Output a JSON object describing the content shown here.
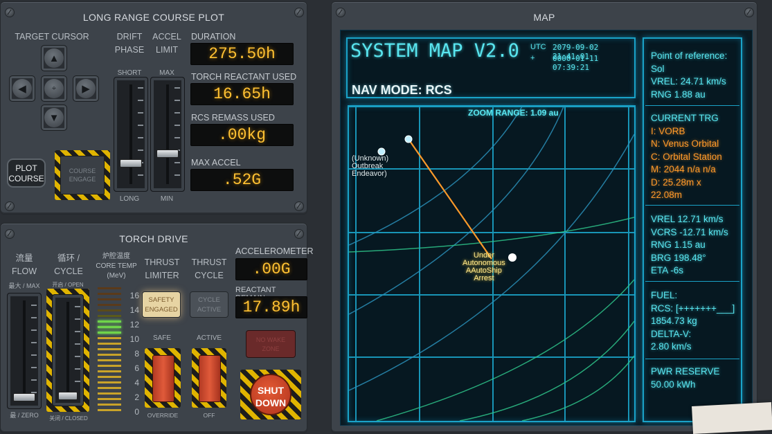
{
  "course_plot": {
    "title": "LONG RANGE COURSE PLOT",
    "target_cursor_label": "TARGET CURSOR",
    "drift_phase_label_1": "DRIFT",
    "drift_phase_label_2": "PHASE",
    "accel_limit_label_1": "ACCEL",
    "accel_limit_label_2": "LIMIT",
    "short_label": "SHORT",
    "long_label": "LONG",
    "max_label": "MAX",
    "min_label": "MIN",
    "plot_course_label_1": "PLOT",
    "plot_course_label_2": "COURSE",
    "course_engage_label_1": "COURSE",
    "course_engage_label_2": "ENGAGE",
    "duration_label": "DURATION",
    "duration_value": "275.50h",
    "torch_used_label": "TORCH REACTANT USED",
    "torch_used_value": "16.65h",
    "rcs_used_label": "RCS REMASS USED",
    "rcs_used_value": ".00kg",
    "max_accel_label": "MAX ACCEL",
    "max_accel_value": ".52G"
  },
  "torch_drive": {
    "title": "TORCH DRIVE",
    "flow_cn": "流量",
    "flow_label": "FLOW",
    "max_label": "最大 / MAX",
    "zero_label": "最 / ZERO",
    "cycle_cn": "循环 /",
    "cycle_label": "CYCLE",
    "open_label": "开启 / OPEN",
    "closed_label": "关闭 / CLOSED",
    "core_temp_cn": "炉腔温度",
    "core_temp_label": "CORE TEMP",
    "core_temp_unit": "(MeV)",
    "temp_scale": [
      "16",
      "14",
      "12",
      "10",
      "8",
      "6",
      "4",
      "2",
      "0"
    ],
    "thrust_limiter_1": "THRUST",
    "thrust_limiter_2": "LIMITER",
    "thrust_cycle_1": "THRUST",
    "thrust_cycle_2": "CYCLE",
    "safety_engaged_1": "SAFETY",
    "safety_engaged_2": "ENGAGED",
    "cycle_active_1": "CYCLE",
    "cycle_active_2": "ACTIVE",
    "safe_label": "SAFE",
    "active_label": "ACTIVE",
    "override_label": "OVERRIDE",
    "off_label": "OFF",
    "accelerometer_label": "ACCELEROMETER",
    "accelerometer_value": ".00G",
    "reactant_label": "REACTANT REMAIN",
    "reactant_value": "17.89h",
    "no_wake_1": "NO WAKE",
    "no_wake_2": "ZONE",
    "shutdown_1": "SHUT",
    "shutdown_2": "DOWN"
  },
  "map": {
    "panel_title": "MAP",
    "system_title": "SYSTEM MAP V2.0",
    "utc_label": "UTC",
    "plus_label": "+",
    "utc_value": "2079-09-02 21:41:01",
    "elapsed_value": "0000-01-11 07:39:21",
    "nav_mode": "NAV MODE: RCS",
    "zoom_range": "ZOOM RANGE: 1.09 au",
    "markers": {
      "label_a": "(Unknown)",
      "label_b": "Outbreak",
      "label_c": "Endeavor)",
      "label_d": "Under",
      "label_e": "Arrest",
      "label_f": "Autonomous",
      "label_g": "AAutoShip"
    }
  },
  "info": {
    "por_label": "Point of reference:",
    "por_value": "Sol",
    "vrel_sol": "VREL: 24.71 km/s",
    "rng_sol": "RNG 1.88 au",
    "current_trg": "CURRENT TRG",
    "trg_i": "I: VORB",
    "trg_n": "N: Venus Orbital",
    "trg_c": "C: Orbital Station",
    "trg_m": "M: 2044 n/a n/a",
    "trg_d1": "D: 25.28m x",
    "trg_d2": "22.08m",
    "vrel_trg": "VREL 12.71 km/s",
    "vcrs_trg": "VCRS -12.71 km/s",
    "rng_trg": "RNG 1.15 au",
    "brg_trg": "BRG 198.48°",
    "eta_trg": "ETA -6s",
    "fuel_label": "FUEL:",
    "rcs_fuel": "RCS: [+++++++___]",
    "rcs_mass": "1854.73 kg",
    "delta_v_label": "DELTA-V:",
    "delta_v_value": "2.80 km/s",
    "pwr_label": "PWR RESERVE",
    "pwr_value": "50.00 kWh"
  },
  "colors": {
    "readout_amber": "#ffc133",
    "screen_cyan": "#59e6f0",
    "target_orange": "#ff9a2a",
    "hazard_yellow": "#e0b400"
  }
}
